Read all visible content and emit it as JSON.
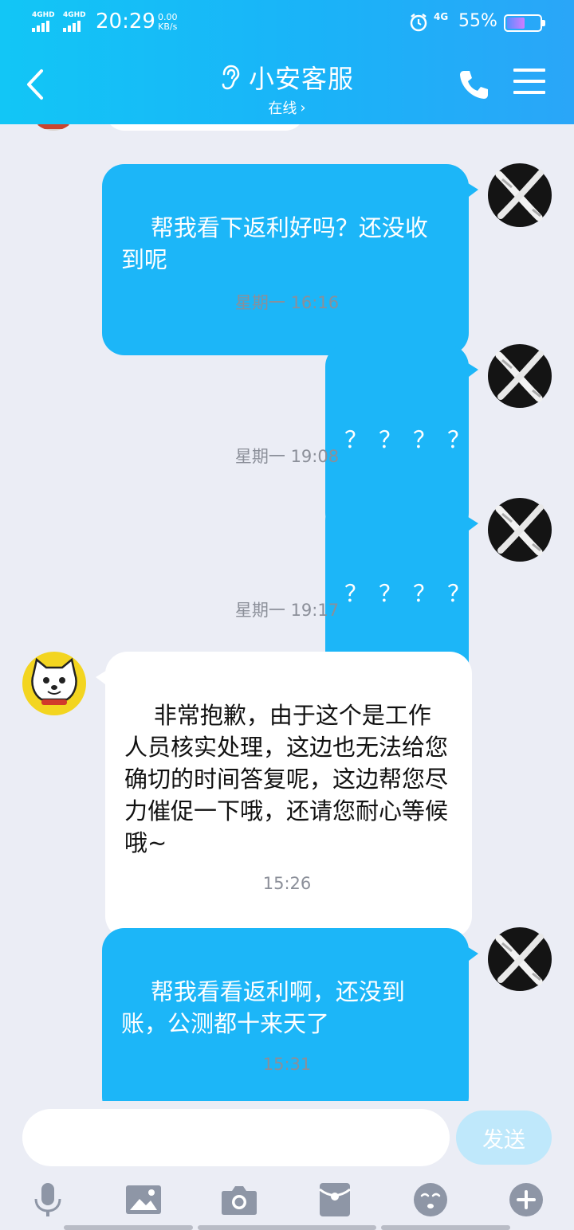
{
  "status_bar": {
    "network_1": "4GHD",
    "network_2": "4GHD",
    "time": "20:29",
    "speed_value": "0.00",
    "speed_unit": "KB/s",
    "mobile_data": "4G",
    "battery_percent": "55%",
    "battery_level": 0.55
  },
  "header": {
    "title": "小安客服",
    "status": "在线",
    "status_chevron": "›"
  },
  "messages": [
    {
      "side": "out",
      "text": "帮我看下返利好吗？还没收到呢"
    },
    {
      "timestamp": "星期一 16:16"
    },
    {
      "side": "out",
      "text": "？？？？"
    },
    {
      "timestamp": "星期一 19:08"
    },
    {
      "side": "out",
      "text": "？？？？"
    },
    {
      "timestamp": "星期一 19:17"
    },
    {
      "side": "in",
      "text": "非常抱歉，由于这个是工作人员核实处理，这边也无法给您确切的时间答复呢，这边帮您尽力催促一下哦，还请您耐心等候哦~"
    },
    {
      "timestamp": "15:26"
    },
    {
      "side": "out",
      "text": "帮我看看返利啊，还没到账，公测都十来天了"
    },
    {
      "timestamp": "15:31"
    }
  ],
  "input": {
    "value": "",
    "placeholder": "",
    "send_label": "发送"
  },
  "toolbar": [
    "microphone-icon",
    "image-icon",
    "camera-icon",
    "red-packet-icon",
    "emoji-icon",
    "plus-icon"
  ],
  "colors": {
    "header_start": "#12c6f6",
    "header_end": "#2aa6f8",
    "outgoing_bubble": "#1cb6f8",
    "incoming_bubble": "#ffffff",
    "background": "#ebedf5",
    "timestamp": "#8b8f99",
    "send_button": "#bfe8fb",
    "toolbar_icon": "#8e96a6"
  }
}
